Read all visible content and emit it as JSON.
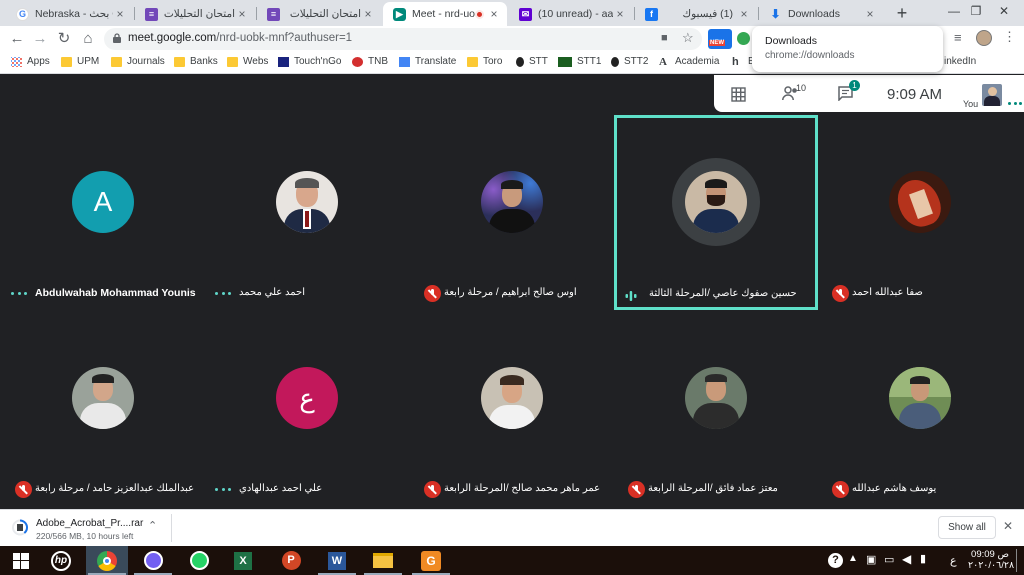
{
  "tabs": [
    {
      "title": "Nebraska - بحث Go",
      "icon": "google-icon",
      "color": "#4285f4"
    },
    {
      "title": "امتحان التحليلات الد",
      "icon": "forms-icon",
      "color": "#7248b9"
    },
    {
      "title": "امتحان التحليلات الد",
      "icon": "forms-icon",
      "color": "#7248b9"
    },
    {
      "title": "Meet - nrd-uob",
      "icon": "meet-icon",
      "color": "#00897b",
      "active": true
    },
    {
      "title": "(10 unread) - aama",
      "icon": "yahoo-mail-icon",
      "color": "#6001d2"
    },
    {
      "title": "(1) فيسبوك",
      "icon": "facebook-icon",
      "color": "#1877f2"
    },
    {
      "title": "Downloads",
      "icon": "download-icon",
      "color": "#1a73e8"
    }
  ],
  "address": {
    "host": "meet.google.com",
    "path": "/nrd-uobk-mnf?authuser=1"
  },
  "toolbar": {
    "new_badge": "NEW"
  },
  "bookmarks": [
    {
      "label": "Apps",
      "icon": "apps-grid-icon"
    },
    {
      "label": "UPM",
      "icon": "folder-icon"
    },
    {
      "label": "Journals",
      "icon": "folder-icon"
    },
    {
      "label": "Banks",
      "icon": "folder-icon"
    },
    {
      "label": "Webs",
      "icon": "folder-icon"
    },
    {
      "label": "Touch'nGo",
      "icon": "tng-icon"
    },
    {
      "label": "TNB",
      "icon": "tnb-icon"
    },
    {
      "label": "Translate",
      "icon": "translate-icon"
    },
    {
      "label": "Toro",
      "icon": "folder-icon"
    },
    {
      "label": "STT",
      "icon": "stt-icon"
    },
    {
      "label": "STT1",
      "icon": "isa-icon"
    },
    {
      "label": "STT2",
      "icon": "stt2-icon"
    },
    {
      "label": "Academia",
      "icon": "academia-icon"
    },
    {
      "label": "E",
      "icon": "h-icon"
    },
    {
      "label": "inkedIn",
      "icon": "linkedin-icon"
    }
  ],
  "downloads_popup": {
    "title": "Downloads",
    "url": "chrome://downloads"
  },
  "meet_bar": {
    "people_count": "10",
    "chat_badge": "1",
    "time": "9:09 AM",
    "you_label": "You"
  },
  "participants": [
    {
      "name": "Abdulwahab Mohammad Younis",
      "avatar": "letter",
      "letter": "A",
      "color": "#129eaf",
      "status": "dots",
      "bold": true
    },
    {
      "name": "احمد علي محمد",
      "avatar": "photo",
      "photo_bg": "#e8e4e0",
      "status": "dots"
    },
    {
      "name": "اوس صالح ابراهيم / مرحلة رابعة",
      "avatar": "photo",
      "photo_bg": "#2b2f5a",
      "status": "muted"
    },
    {
      "name": "حسين صفوك عاصي /المرحلة الثالثة",
      "avatar": "photo",
      "photo_bg": "#c9b9a5",
      "status": "speaking",
      "highlight": true
    },
    {
      "name": "صفا عبدالله احمد",
      "avatar": "photo",
      "photo_bg": "#b5331c",
      "status": "muted"
    },
    {
      "name": "عبدالملك عبدالعزيز حامد / مرحلة رابعة",
      "avatar": "photo",
      "photo_bg": "#9aa29a",
      "status": "muted"
    },
    {
      "name": "علي احمد عبدالهادي",
      "avatar": "letter",
      "letter": "ع",
      "color": "#c2185b",
      "status": "dots"
    },
    {
      "name": "عمر ماهر محمد صالح /المرحلة الرابعة",
      "avatar": "photo",
      "photo_bg": "#c8c1b4",
      "status": "muted"
    },
    {
      "name": "معتز عماد فائق /المرحلة الرابعة",
      "avatar": "photo",
      "photo_bg": "#6a7a6a",
      "status": "muted"
    },
    {
      "name": "يوسف هاشم عبدالله",
      "avatar": "photo",
      "photo_bg": "#6f8d55",
      "status": "muted"
    }
  ],
  "download_shelf": {
    "file": "Adobe_Acrobat_Pr....rar",
    "progress": "220/566 MB, 10 hours left",
    "progress_fraction": 0.39,
    "show_all": "Show all"
  },
  "taskbar": {
    "apps": [
      "windows-start-icon",
      "hp-icon",
      "chrome-icon",
      "viber-icon",
      "whatsapp-icon",
      "excel-icon",
      "powerpoint-icon",
      "word-icon",
      "file-explorer-icon",
      "pdf-tool-icon"
    ],
    "clock_period": "ص",
    "clock_time": "09:09",
    "clock_date": "٢٠٢٠/٠٦/٢٨",
    "lang": "ع"
  }
}
